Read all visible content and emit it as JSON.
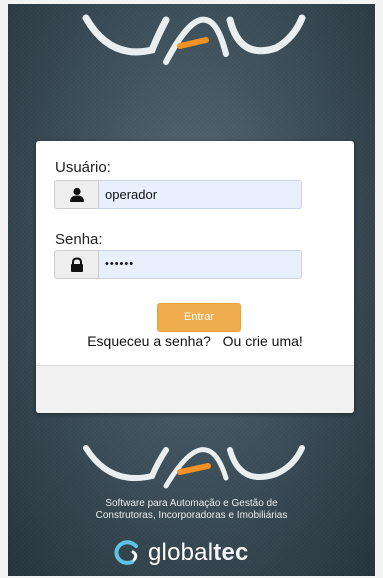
{
  "brand": {
    "logo_name": "UAU",
    "tagline_line1": "Software para Automação e Gestão de",
    "tagline_line2": "Construtoras, Incorporadoras e Imobiliárias",
    "company_part1": "global",
    "company_part2": "tec"
  },
  "login": {
    "user_label": "Usuário:",
    "user_value": "operador",
    "password_label": "Senha:",
    "password_value": "••••••",
    "submit_label": "Entrar",
    "forgot_link": "Esqueceu a senha?",
    "signup_link": "Ou crie uma!"
  },
  "colors": {
    "accent_orange": "#f0ad4e",
    "input_fill": "#e8f0fe",
    "background": "#3f525c"
  },
  "icons": {
    "user_addon": "user-icon",
    "password_addon": "lock-icon",
    "company_logo": "globaltec-swirl-icon"
  }
}
